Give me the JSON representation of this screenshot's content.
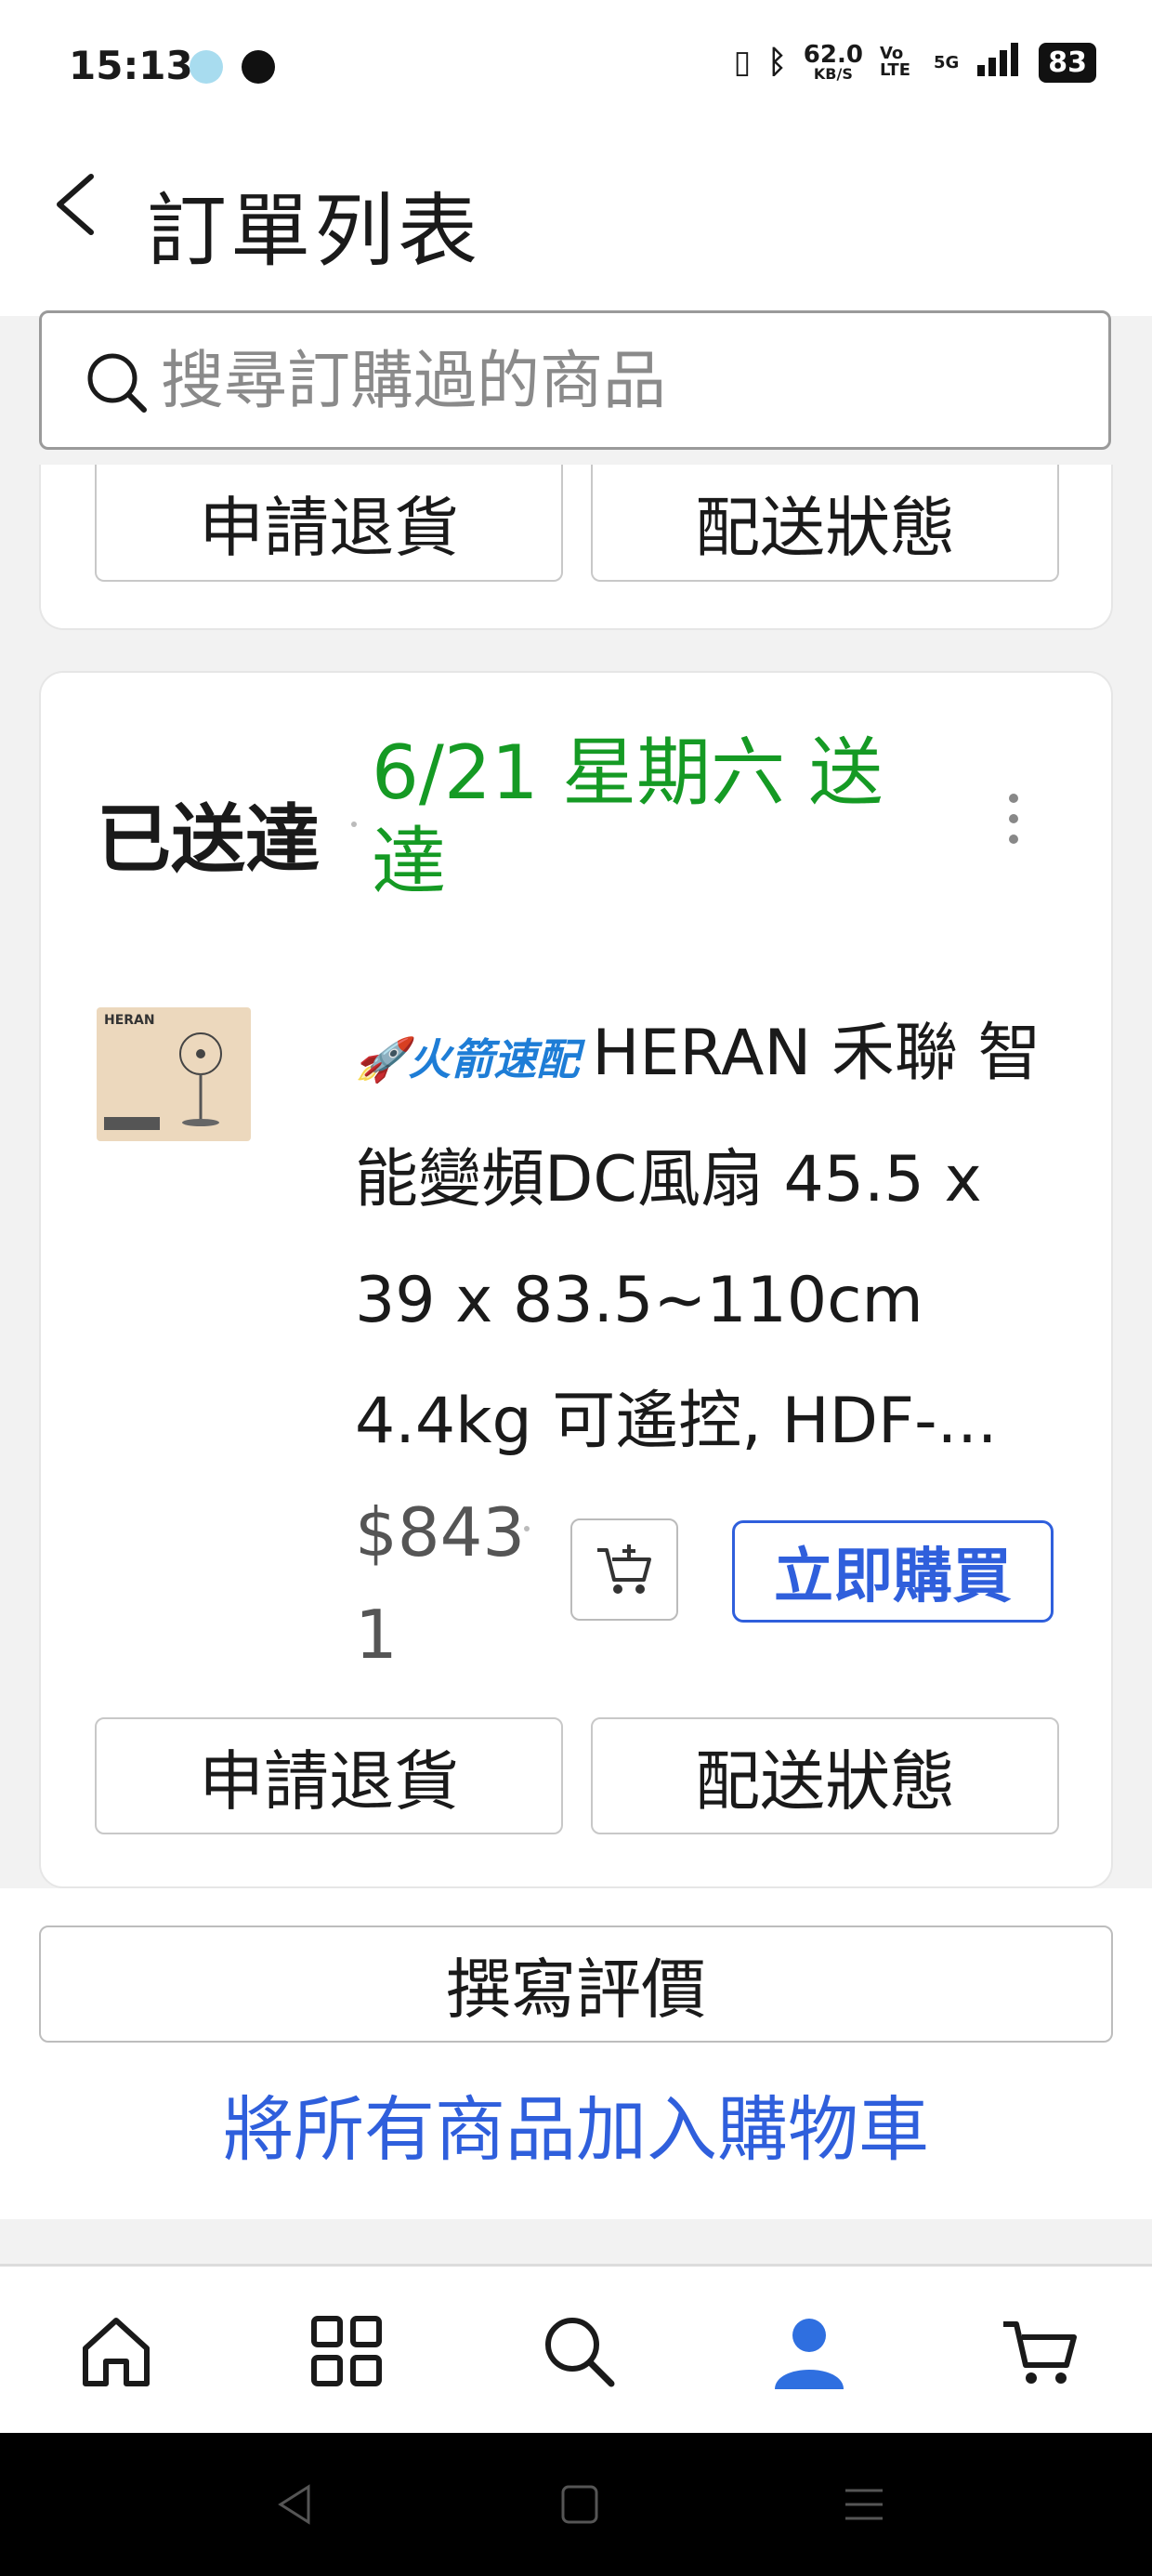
{
  "status_bar": {
    "time": "15:13",
    "network_speed": "62.0",
    "network_unit": "KB/S",
    "volte": "Vo LTE",
    "signal": "5G",
    "battery": "83"
  },
  "header": {
    "title": "訂單列表"
  },
  "search": {
    "placeholder": "搜尋訂購過的商品"
  },
  "previous_order": {
    "return_button": "申請退貨",
    "shipping_status_button": "配送狀態"
  },
  "order": {
    "status": "已送達",
    "delivery_date": "6/21 星期六 送達",
    "product": {
      "badge": "火箭速配",
      "name": "HERAN 禾聯 智能變頻DC風扇 45.5 x 39 x 83.5~110cm 4.4kg 可遙控, HDF-...",
      "price": "$843 1",
      "thumbnail_brand": "HERAN"
    },
    "buy_now_button": "立即購買",
    "return_button": "申請退貨",
    "shipping_status_button": "配送狀態"
  },
  "write_review_button": "撰寫評價",
  "add_all_to_cart_link": "將所有商品加入購物車",
  "tab_bar": {
    "items": [
      "home-icon",
      "categories-icon",
      "search-icon",
      "account-icon",
      "cart-icon"
    ],
    "active": "account-icon",
    "active_color": "#2f6fe0"
  },
  "colors": {
    "delivered_green": "#159a24",
    "link_blue": "#2f5fdc",
    "badge_blue": "#1e7dd6"
  }
}
